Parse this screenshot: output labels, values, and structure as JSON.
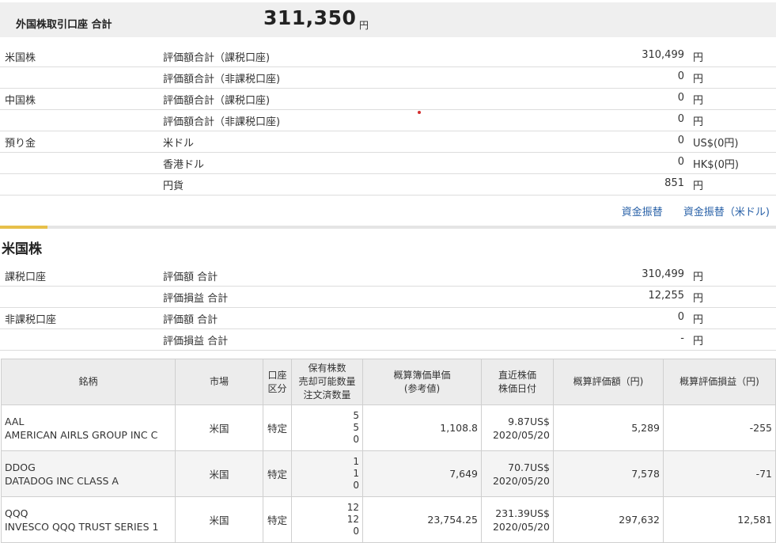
{
  "header": {
    "title": "外国株取引口座 合計",
    "amount": "311,350",
    "unit": "円"
  },
  "summary": [
    {
      "c1": "米国株",
      "c2": "評価額合計（課税口座)",
      "value": "310,499",
      "unit": "円"
    },
    {
      "c1": "",
      "c2": "評価額合計（非課税口座)",
      "value": "0",
      "unit": "円"
    },
    {
      "c1": "中国株",
      "c2": "評価額合計（課税口座)",
      "value": "0",
      "unit": "円"
    },
    {
      "c1": "",
      "c2": "評価額合計（非課税口座)",
      "value": "0",
      "unit": "円"
    },
    {
      "c1": "預り金",
      "c2": "米ドル",
      "value": "0",
      "unit": "US$(0円)"
    },
    {
      "c1": "",
      "c2": "香港ドル",
      "value": "0",
      "unit": "HK$(0円)"
    },
    {
      "c1": "",
      "c2": "円貨",
      "value": "851",
      "unit": "円"
    }
  ],
  "links": {
    "transfer": "資金振替",
    "transfer_usd": "資金振替（米ドル)"
  },
  "us_section": {
    "title": "米国株",
    "rows": [
      {
        "c1": "課税口座",
        "c2": "評価額 合計",
        "value": "310,499",
        "unit": "円"
      },
      {
        "c1": "",
        "c2": "評価損益 合計",
        "value": "12,255",
        "unit": "円"
      },
      {
        "c1": "非課税口座",
        "c2": "評価額 合計",
        "value": "0",
        "unit": "円"
      },
      {
        "c1": "",
        "c2": "評価損益 合計",
        "value": "-",
        "unit": "円"
      }
    ]
  },
  "table": {
    "headers": {
      "name": "銘柄",
      "market": "市場",
      "account_1": "口座",
      "account_2": "区分",
      "qty_1": "保有株数",
      "qty_2": "売却可能数量",
      "qty_3": "注文済数量",
      "cost_1": "概算簿価単価",
      "cost_2": "(参考値)",
      "price_1": "直近株価",
      "price_2": "株価日付",
      "value": "概算評価額（円)",
      "pl": "概算評価損益（円)"
    },
    "rows": [
      {
        "ticker": "AAL",
        "name": "AMERICAN AIRLS GROUP INC C",
        "market": "米国",
        "account": "特定",
        "held": "5",
        "sellable": "5",
        "ordered": "0",
        "cost": "1,108.8",
        "price": "9.87US$",
        "date": "2020/05/20",
        "value": "5,289",
        "pl": "-255"
      },
      {
        "ticker": "DDOG",
        "name": "DATADOG INC CLASS A",
        "market": "米国",
        "account": "特定",
        "held": "1",
        "sellable": "1",
        "ordered": "0",
        "cost": "7,649",
        "price": "70.7US$",
        "date": "2020/05/20",
        "value": "7,578",
        "pl": "-71"
      },
      {
        "ticker": "QQQ",
        "name": "INVESCO QQQ TRUST SERIES 1",
        "market": "米国",
        "account": "特定",
        "held": "12",
        "sellable": "12",
        "ordered": "0",
        "cost": "23,754.25",
        "price": "231.39US$",
        "date": "2020/05/20",
        "value": "297,632",
        "pl": "12,581"
      }
    ]
  },
  "colors": {
    "link": "#2a62a8",
    "negative": "#c2185b",
    "accent": "#e7c04a"
  }
}
